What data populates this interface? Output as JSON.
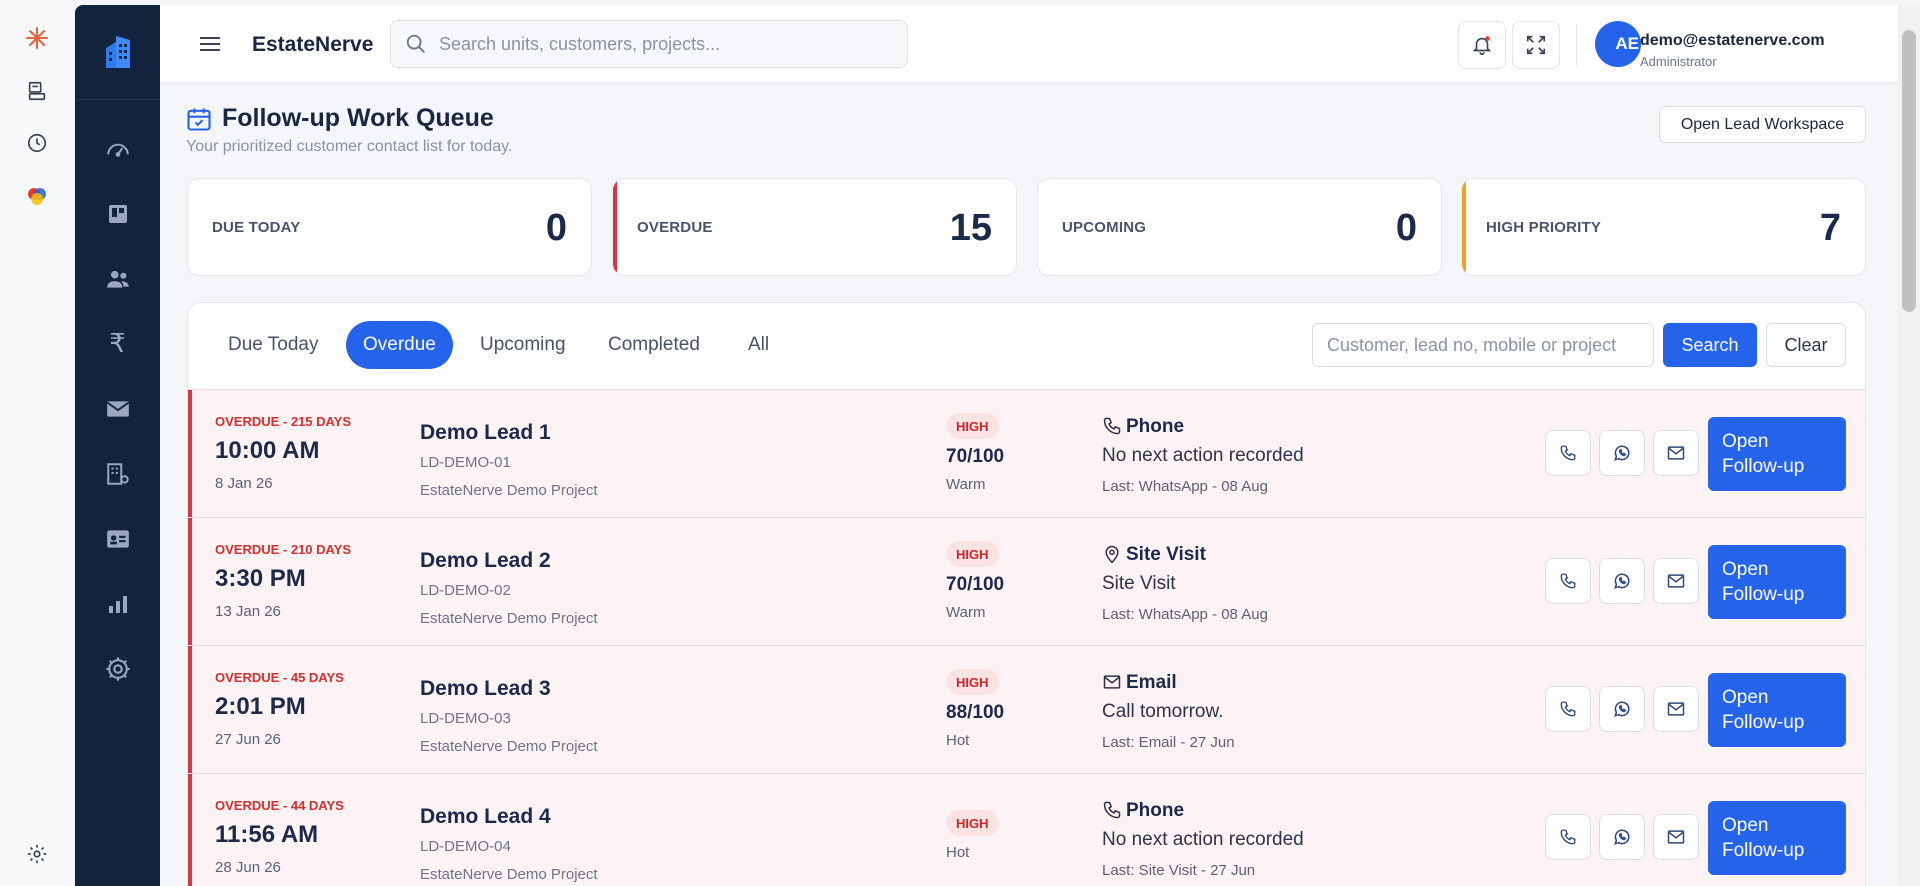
{
  "header": {
    "brand": "EstateNerve",
    "search_placeholder": "Search units, customers, projects...",
    "user_email": "demo@estatenerve.com",
    "user_role": "Administrator",
    "avatar_initials": "AE"
  },
  "page": {
    "title": "Follow-up Work Queue",
    "subtitle": "Your prioritized customer contact list for today.",
    "open_workspace_label": "Open Lead Workspace"
  },
  "stats": [
    {
      "label": "DUE TODAY",
      "value": "0",
      "accent": ""
    },
    {
      "label": "OVERDUE",
      "value": "15",
      "accent": "#dc3545"
    },
    {
      "label": "UPCOMING",
      "value": "0",
      "accent": ""
    },
    {
      "label": "HIGH PRIORITY",
      "value": "7",
      "accent": "#f0a020"
    }
  ],
  "tabs": [
    {
      "label": "Due Today",
      "active": false
    },
    {
      "label": "Overdue",
      "active": true
    },
    {
      "label": "Upcoming",
      "active": false
    },
    {
      "label": "Completed",
      "active": false
    },
    {
      "label": "All",
      "active": false
    }
  ],
  "filter": {
    "placeholder": "Customer, lead no, mobile or project",
    "search_label": "Search",
    "clear_label": "Clear"
  },
  "rows": [
    {
      "overdue": "OVERDUE - 215 DAYS",
      "time": "10:00 AM",
      "date": "8 Jan 26",
      "name": "Demo Lead 1",
      "lead_no": "LD-DEMO-01",
      "project": "EstateNerve Demo Project",
      "priority": "HIGH",
      "score": "70/100",
      "temperature": "Warm",
      "type": "Phone",
      "type_icon": "phone-icon",
      "next_action": "No next action recorded",
      "last": "Last: WhatsApp - 08 Aug",
      "open_label": "Open Follow-up"
    },
    {
      "overdue": "OVERDUE - 210 DAYS",
      "time": "3:30 PM",
      "date": "13 Jan 26",
      "name": "Demo Lead 2",
      "lead_no": "LD-DEMO-02",
      "project": "EstateNerve Demo Project",
      "priority": "HIGH",
      "score": "70/100",
      "temperature": "Warm",
      "type": "Site Visit",
      "type_icon": "map-pin-icon",
      "next_action": "Site Visit",
      "last": "Last: WhatsApp - 08 Aug",
      "open_label": "Open Follow-up"
    },
    {
      "overdue": "OVERDUE - 45 DAYS",
      "time": "2:01 PM",
      "date": "27 Jun 26",
      "name": "Demo Lead 3",
      "lead_no": "LD-DEMO-03",
      "project": "EstateNerve Demo Project",
      "priority": "HIGH",
      "score": "88/100",
      "temperature": "Hot",
      "type": "Email",
      "type_icon": "mail-icon",
      "next_action": "Call tomorrow.",
      "last": "Last: Email - 27 Jun",
      "open_label": "Open Follow-up"
    },
    {
      "overdue": "OVERDUE - 44 DAYS",
      "time": "11:56 AM",
      "date": "28 Jun 26",
      "name": "Demo Lead 4",
      "lead_no": "LD-DEMO-04",
      "project": "EstateNerve Demo Project",
      "priority": "HIGH",
      "score": "",
      "temperature": "Hot",
      "type": "Phone",
      "type_icon": "phone-icon",
      "next_action": "No next action recorded",
      "last": "Last: Site Visit - 27 Jun",
      "open_label": "Open Follow-up"
    }
  ],
  "colors": {
    "primary": "#2563eb",
    "sidebar": "#14233d",
    "overdue_red": "#dc3545",
    "priority_amber": "#f0a020"
  }
}
